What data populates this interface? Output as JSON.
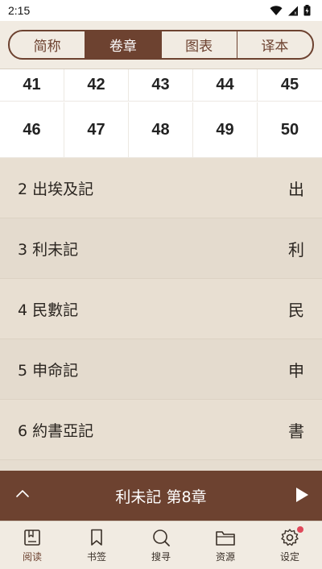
{
  "status_bar": {
    "time": "2:15"
  },
  "tabs": [
    {
      "label": "简称",
      "active": false
    },
    {
      "label": "卷章",
      "active": true
    },
    {
      "label": "图表",
      "active": false
    },
    {
      "label": "译本",
      "active": false
    }
  ],
  "chapter_grid": {
    "row1": [
      "41",
      "42",
      "43",
      "44",
      "45"
    ],
    "row2": [
      "46",
      "47",
      "48",
      "49",
      "50"
    ]
  },
  "books": [
    {
      "name": "2 出埃及記",
      "abbr": "出"
    },
    {
      "name": "3 利未記",
      "abbr": "利"
    },
    {
      "name": "4 民數記",
      "abbr": "民"
    },
    {
      "name": "5 申命記",
      "abbr": "申"
    },
    {
      "name": "6 約書亞記",
      "abbr": "書"
    }
  ],
  "nav_bar": {
    "title": "利未記 第8章"
  },
  "bottom_nav": [
    {
      "label": "阅读",
      "icon": "book-open-icon"
    },
    {
      "label": "书签",
      "icon": "bookmark-icon"
    },
    {
      "label": "搜寻",
      "icon": "search-icon"
    },
    {
      "label": "资源",
      "icon": "folder-icon"
    },
    {
      "label": "设定",
      "icon": "gear-icon"
    }
  ],
  "colors": {
    "accent": "#6d4230",
    "background": "#e6ddd0",
    "notification_dot": "#e0485a"
  }
}
